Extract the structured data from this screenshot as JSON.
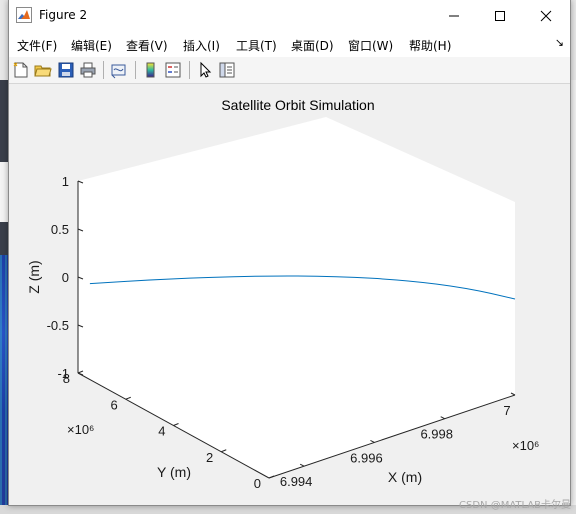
{
  "window": {
    "title": "Figure 2"
  },
  "menu": {
    "items": [
      {
        "label": "文件(F)"
      },
      {
        "label": "编辑(E)"
      },
      {
        "label": "查看(V)"
      },
      {
        "label": "插入(I)"
      },
      {
        "label": "工具(T)"
      },
      {
        "label": "桌面(D)"
      },
      {
        "label": "窗口(W)"
      },
      {
        "label": "帮助(H)"
      }
    ]
  },
  "toolbar": {
    "icons": [
      "new-figure-icon",
      "open-file-icon",
      "save-icon",
      "print-icon",
      "link-plot-icon",
      "colorbar-icon",
      "legend-icon",
      "pointer-icon",
      "property-inspector-icon"
    ]
  },
  "chart_data": {
    "type": "line",
    "title": "Satellite Orbit Simulation",
    "xlabel": "X (m)",
    "ylabel": "Y (m)",
    "zlabel": "Z (m)",
    "xlim": [
      6.993,
      7.0
    ],
    "ylim": [
      0,
      8
    ],
    "zlim": [
      -1,
      1
    ],
    "x_ticks": [
      "6.994",
      "6.996",
      "6.998",
      "7"
    ],
    "y_ticks": [
      "0",
      "2",
      "4",
      "6",
      "8"
    ],
    "z_ticks": [
      "-1",
      "-0.5",
      "0",
      "0.5",
      "1"
    ],
    "x_exponent": "×10⁶",
    "y_exponent": "×10⁶",
    "series": [
      {
        "color": "#0072bd",
        "x": [
          7.0,
          6.9995,
          6.9987,
          6.9976,
          6.9962,
          6.9945,
          6.993
        ],
        "y": [
          0,
          1.3,
          2.6,
          3.9,
          5.2,
          6.5,
          7.5
        ],
        "z": [
          0,
          0,
          0,
          0,
          0,
          0,
          0
        ]
      }
    ]
  },
  "watermark": "CSDN @MATLAB卡尔曼"
}
